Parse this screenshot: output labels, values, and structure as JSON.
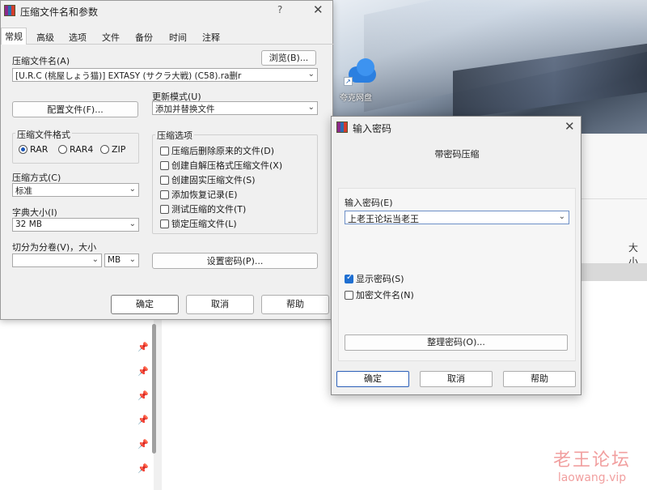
{
  "desktop": {
    "icon_label": "夸克网盘",
    "explorer_size_header": "大小"
  },
  "main_dialog": {
    "title": "压缩文件名和参数",
    "help": "?",
    "close": "✕",
    "tabs": [
      "常规",
      "高级",
      "选项",
      "文件",
      "备份",
      "时间",
      "注释"
    ],
    "archive_name_label": "压缩文件名(A)",
    "browse_button": "浏览(B)...",
    "archive_name_value": "[U.R.C (桃屋しょう猫)] EXTASY (サクラ大戦) (C58).ra删r",
    "profiles_button": "配置文件(F)...",
    "update_mode_label": "更新模式(U)",
    "update_mode_value": "添加并替换文件",
    "format_group": "压缩文件格式",
    "formats": [
      {
        "label": "RAR",
        "selected": true
      },
      {
        "label": "RAR4",
        "selected": false
      },
      {
        "label": "ZIP",
        "selected": false
      }
    ],
    "options_group": "压缩选项",
    "options": [
      {
        "label": "压缩后删除原来的文件(D)",
        "checked": false
      },
      {
        "label": "创建自解压格式压缩文件(X)",
        "checked": false
      },
      {
        "label": "创建固实压缩文件(S)",
        "checked": false
      },
      {
        "label": "添加恢复记录(E)",
        "checked": false
      },
      {
        "label": "测试压缩的文件(T)",
        "checked": false
      },
      {
        "label": "锁定压缩文件(L)",
        "checked": false
      }
    ],
    "method_label": "压缩方式(C)",
    "method_value": "标准",
    "dict_label": "字典大小(I)",
    "dict_value": "32 MB",
    "split_label": "切分为分卷(V)，大小",
    "split_value": "",
    "split_unit": "MB",
    "set_password_button": "设置密码(P)...",
    "ok": "确定",
    "cancel": "取消",
    "help_button": "帮助"
  },
  "password_dialog": {
    "title": "输入密码",
    "close": "✕",
    "subtitle": "带密码压缩",
    "enter_label": "输入密码(E)",
    "password_value": "上老王论坛当老王",
    "show_password": {
      "label": "显示密码(S)",
      "checked": true
    },
    "encrypt_names": {
      "label": "加密文件名(N)",
      "checked": false
    },
    "organize_button": "整理密码(O)...",
    "ok": "确定",
    "cancel": "取消",
    "help": "帮助"
  },
  "watermark": {
    "cn": "老王论坛",
    "en": "laowang.vip"
  },
  "colors": {
    "accent": "#1f6fd1",
    "dialog_bg": "#f0f0f0"
  }
}
